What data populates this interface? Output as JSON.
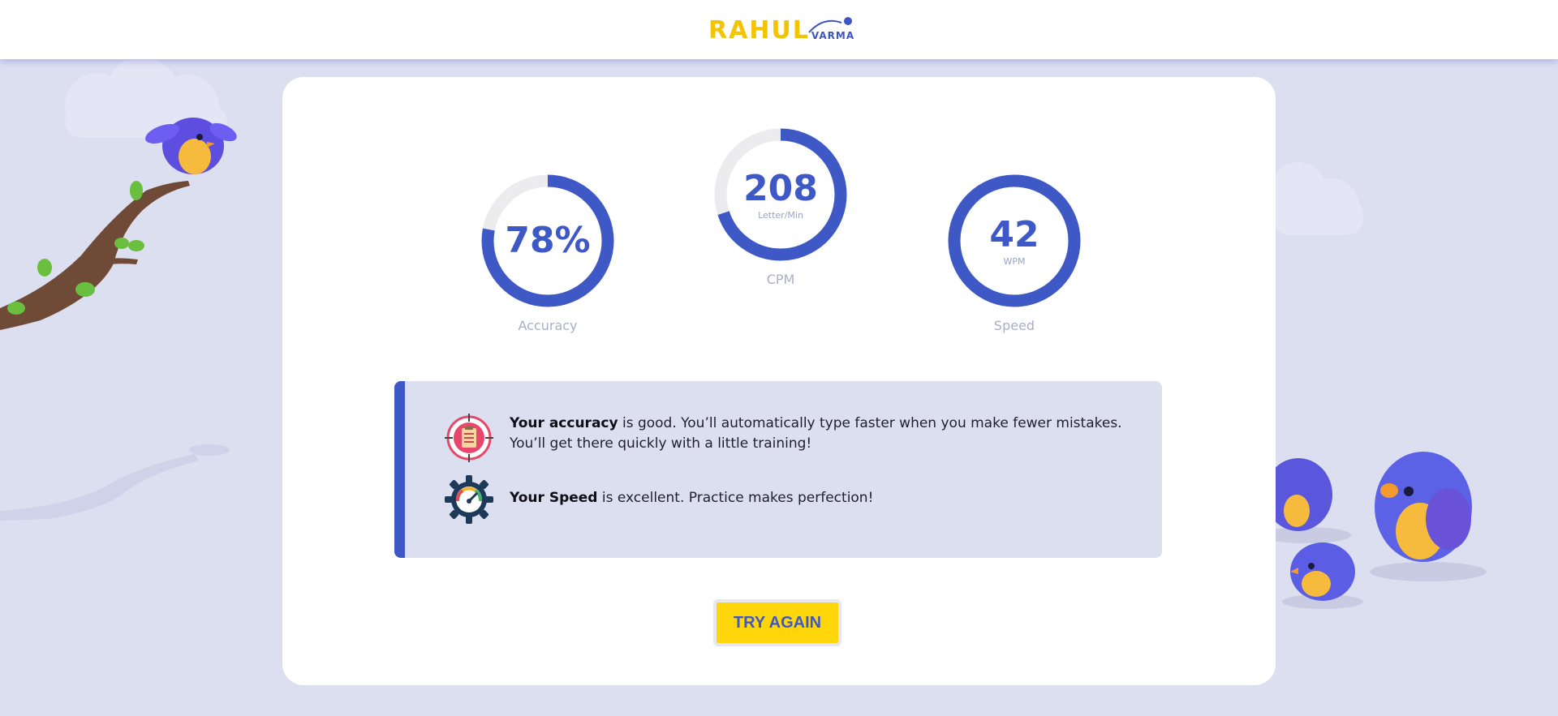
{
  "header": {
    "logo_main": "RAHUL",
    "logo_sub": "VARMA"
  },
  "results": {
    "accuracy": {
      "value_text": "78%",
      "percent": 78,
      "caption": "Accuracy"
    },
    "cpm": {
      "value_text": "208",
      "unit": "Letter/Min",
      "caption": "CPM",
      "fill_fraction": 0.7
    },
    "speed": {
      "value_text": "42",
      "unit": "WPM",
      "caption": "Speed",
      "fill_fraction": 1.0
    }
  },
  "feedback": {
    "accuracy_bold": "Your accuracy",
    "accuracy_text": " is good. You’ll automatically type faster when you make fewer mistakes. You’ll get there quickly with a little training!",
    "speed_bold": "Your Speed",
    "speed_text": " is excellent. Practice makes perfection!",
    "accuracy_icon": "target-clipboard-icon",
    "speed_icon": "speedometer-gear-icon"
  },
  "actions": {
    "try_again_label": "TRY AGAIN"
  },
  "colors": {
    "accent": "#3e58c6",
    "track": "#ececef",
    "brand_yellow": "#f5c400",
    "button_yellow": "#ffd60a",
    "background": "#dcdff0"
  }
}
